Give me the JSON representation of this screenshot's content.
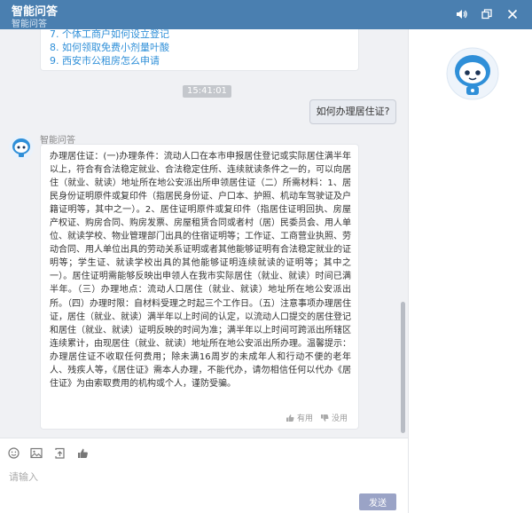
{
  "header": {
    "title": "智能问答",
    "subtitle": "智能问答",
    "icons": [
      "speaker-icon",
      "restore-icon",
      "close-icon"
    ]
  },
  "previous_suggestions": [
    "7. 个体工商户如何设立登记",
    "8. 如何领取免费小剂量叶酸",
    "9. 西安市公租房怎么申请"
  ],
  "conversation": {
    "timestamp": "15:41:01",
    "user_question": "如何办理居住证?",
    "bot_name": "智能问答",
    "bot_answer": "办理居住证：(一)办理条件：流动人口在本市申报居住登记或实际居住满半年以上，符合有合法稳定就业、合法稳定住所、连续就读条件之一的，可以向居住（就业、就读）地址所在地公安派出所申领居住证（二）所需材料：1、居民身份证明原件或复印件（指居民身份证、户口本、护照、机动车驾驶证及户籍证明等，其中之一）。2、居住证明原件或复印件（指居住证明回执、房屋产权证、购房合同、购房发票、房屋租赁合同或者村（居）民委员会、用人单位、就读学校、物业管理部门出具的住宿证明等；工作证、工商营业执照、劳动合同、用人单位出具的劳动关系证明或者其他能够证明有合法稳定就业的证明等；学生证、就读学校出具的其他能够证明连续就读的证明等；其中之一）。居住证明需能够反映出申领人在我市实际居住（就业、就读）时间已满半年。（三）办理地点：流动人口居住（就业、就读）地址所在地公安派出所。（四）办理时限：自材料受理之时起三个工作日。（五）注意事项办理居住证，居住（就业、就读）满半年以上时间的认定，以流动人口提交的居住登记和居住（就业、就读）证明反映的时间为准；满半年以上时间可跨派出所辖区连续累计，由现居住（就业、就读）地址所在地公安派出所办理。温馨提示：办理居住证不收取任何费用；除未满16周岁的未成年人和行动不便的老年人、残疾人等，《居住证》需本人办理，不能代办，请勿相信任何以代办《居住证》为由索取费用的机构或个人，谨防受骗。",
    "useful_label": "有用",
    "useless_label": "没用"
  },
  "input": {
    "placeholder": "请输入",
    "value": "",
    "toolbar_icons": [
      "emoji-icon",
      "image-icon",
      "upload-icon",
      "thumbs-up-icon"
    ]
  },
  "send_label": "发送",
  "colors": {
    "header_bg": "#4a7fb0",
    "link": "#2f8fd8",
    "chat_bg": "#f0f1f4",
    "send_bg": "#9aa3c6"
  }
}
